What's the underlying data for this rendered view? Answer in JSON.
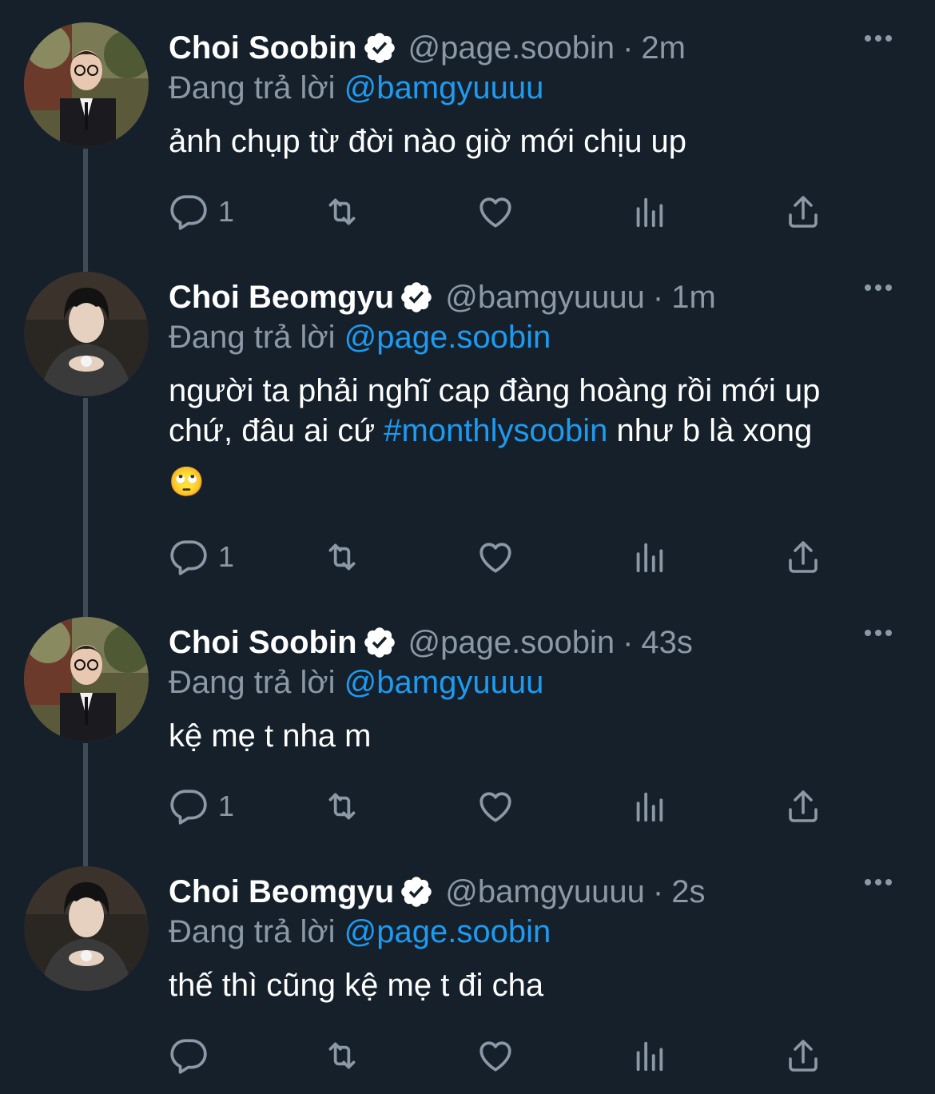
{
  "tweets": [
    {
      "name": "Choi Soobin",
      "handle": "@page.soobin",
      "dot": "·",
      "time": "2m",
      "reply_prefix": "Đang trả lời",
      "reply_to": "@bamgyuuuu",
      "text_parts": [
        "ảnh chụp từ đời nào giờ mới chịu up"
      ],
      "reply_count": "1",
      "avatar": "soobin-avatar"
    },
    {
      "name": "Choi Beomgyu",
      "handle": "@bamgyuuuu",
      "dot": "·",
      "time": "1m",
      "reply_prefix": "Đang trả lời",
      "reply_to": "@page.soobin",
      "text_line1": "người ta phải nghĩ cap đàng hoàng rồi mới up",
      "text_line2_before": "chứ, đâu ai cứ ",
      "hashtag": "#monthlysoobin",
      "text_line2_after": " như b là xong",
      "emoji": "🙄",
      "reply_count": "1",
      "avatar": "beomgyu-avatar"
    },
    {
      "name": "Choi Soobin",
      "handle": "@page.soobin",
      "dot": "·",
      "time": "43s",
      "reply_prefix": "Đang trả lời",
      "reply_to": "@bamgyuuuu",
      "text_parts": [
        "kệ mẹ t nha m"
      ],
      "reply_count": "1",
      "avatar": "soobin-avatar"
    },
    {
      "name": "Choi Beomgyu",
      "handle": "@bamgyuuuu",
      "dot": "·",
      "time": "2s",
      "reply_prefix": "Đang trả lời",
      "reply_to": "@page.soobin",
      "text_parts": [
        "thế thì cũng kệ mẹ t đi cha"
      ],
      "reply_count": "",
      "avatar": "beomgyu-avatar"
    }
  ],
  "icons": {
    "reply": "reply-icon",
    "retweet": "retweet-icon",
    "like": "heart-icon",
    "views": "views-icon",
    "share": "share-icon",
    "more": "more-icon",
    "verified": "verified-badge-icon"
  },
  "colors": {
    "background": "#15202b",
    "primary_text": "#ffffff",
    "secondary_text": "#8b98a5",
    "link": "#1d9bf0",
    "thread_line": "#3d4a57"
  }
}
